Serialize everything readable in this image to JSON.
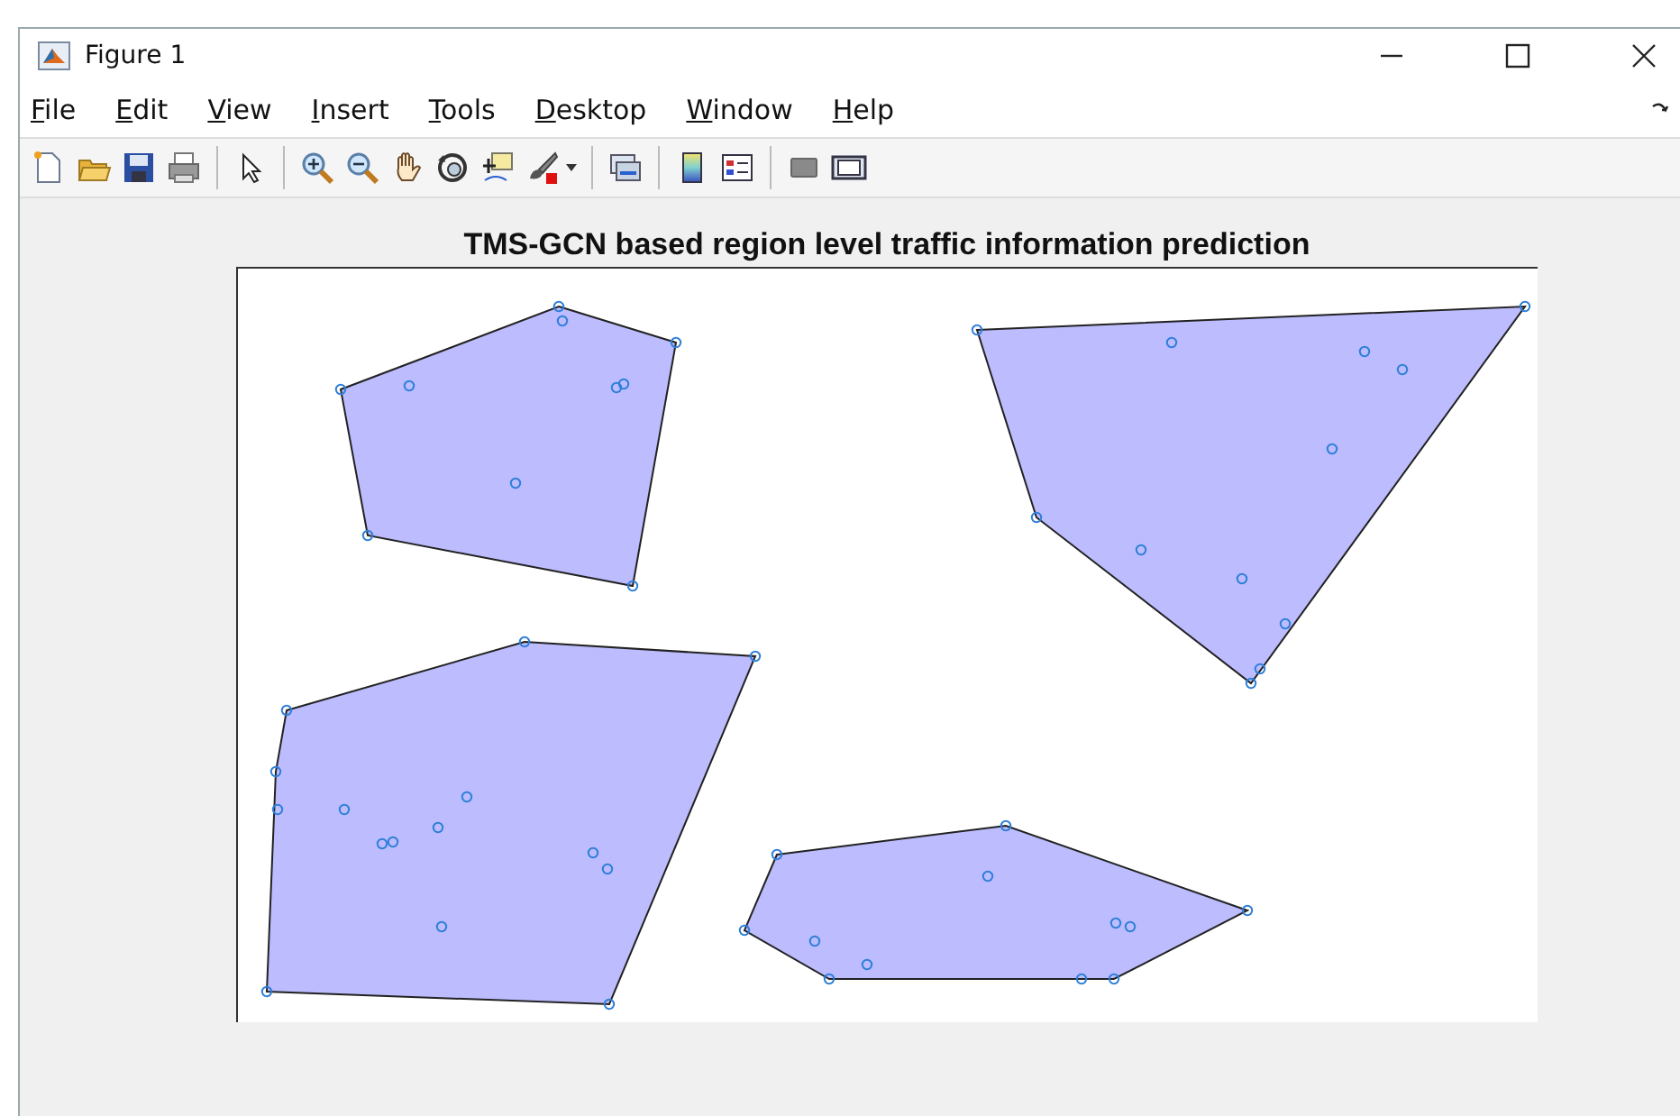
{
  "window": {
    "title": "Figure 1"
  },
  "menu": [
    "File",
    "Edit",
    "View",
    "Insert",
    "Tools",
    "Desktop",
    "Window",
    "Help"
  ],
  "plot": {
    "title": "TMS-GCN based region level traffic information prediction",
    "kind": "picture"
  }
}
